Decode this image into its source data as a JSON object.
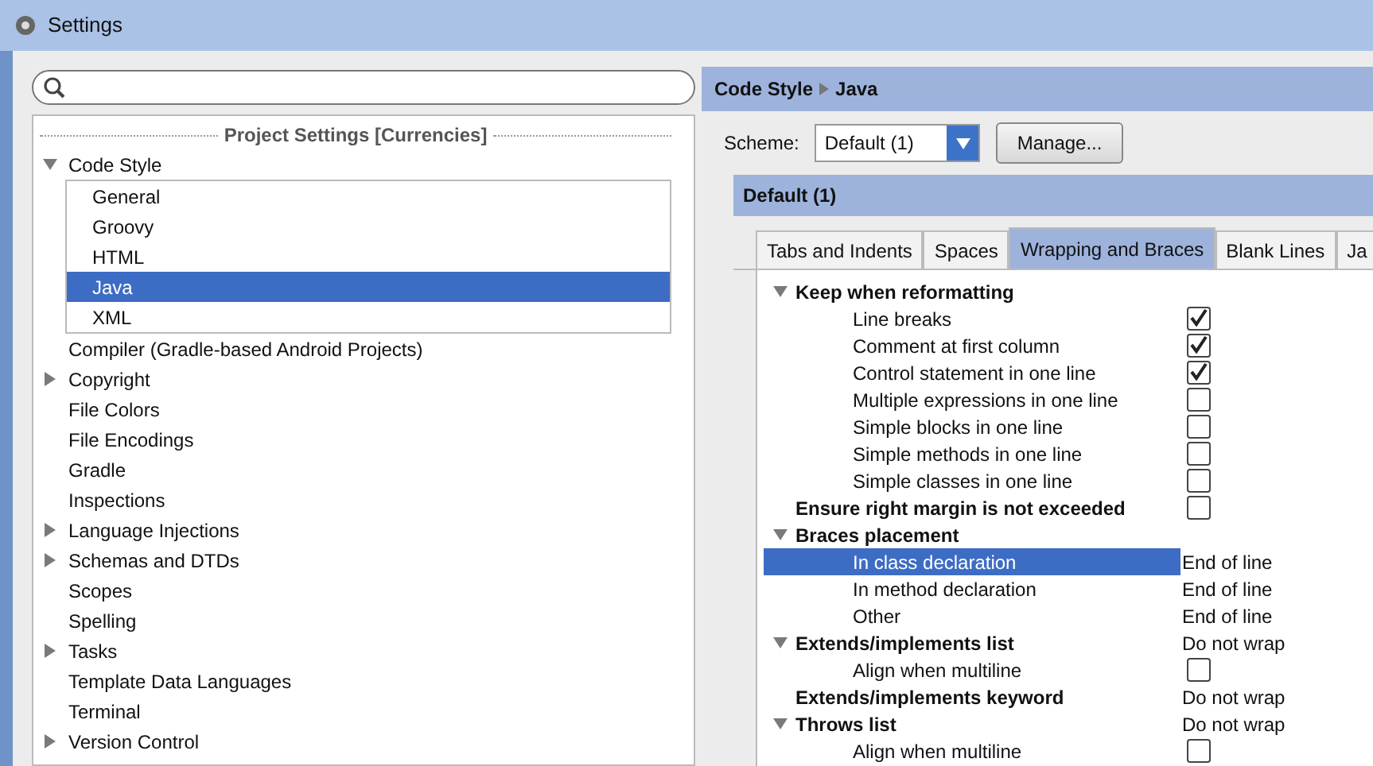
{
  "window": {
    "title": "Settings"
  },
  "tree": {
    "section": "Project Settings [Currencies]",
    "items": [
      {
        "label": "Code Style",
        "expanded": true,
        "selected": false,
        "children": [
          {
            "label": "General",
            "selected": false
          },
          {
            "label": "Groovy",
            "selected": false
          },
          {
            "label": "HTML",
            "selected": false
          },
          {
            "label": "Java",
            "selected": true
          },
          {
            "label": "XML",
            "selected": false
          }
        ]
      },
      {
        "label": "Compiler (Gradle-based Android Projects)",
        "selected": false
      },
      {
        "label": "Copyright",
        "expanded": false,
        "selected": false
      },
      {
        "label": "File Colors",
        "selected": false
      },
      {
        "label": "File Encodings",
        "selected": false
      },
      {
        "label": "Gradle",
        "selected": false
      },
      {
        "label": "Inspections",
        "selected": false
      },
      {
        "label": "Language Injections",
        "expanded": false,
        "selected": false
      },
      {
        "label": "Schemas and DTDs",
        "expanded": false,
        "selected": false
      },
      {
        "label": "Scopes",
        "selected": false
      },
      {
        "label": "Spelling",
        "selected": false
      },
      {
        "label": "Tasks",
        "expanded": false,
        "selected": false
      },
      {
        "label": "Template Data Languages",
        "selected": false
      },
      {
        "label": "Terminal",
        "selected": false
      },
      {
        "label": "Version Control",
        "expanded": false,
        "selected": false
      }
    ]
  },
  "breadcrumb": {
    "parent": "Code Style",
    "current": "Java"
  },
  "scheme": {
    "label": "Scheme:",
    "value": "Default (1)",
    "manage_button": "Manage..."
  },
  "scheme_header": "Default (1)",
  "tabs": [
    {
      "label": "Tabs and Indents",
      "selected": false
    },
    {
      "label": "Spaces",
      "selected": false
    },
    {
      "label": "Wrapping and Braces",
      "selected": true
    },
    {
      "label": "Blank Lines",
      "selected": false
    },
    {
      "label": "Ja",
      "selected": false
    }
  ],
  "options": [
    {
      "kind": "group",
      "label": "Keep when reformatting",
      "expanded": true,
      "selected": false,
      "children": [
        {
          "kind": "checkbox",
          "label": "Line breaks",
          "checked": true,
          "selected": false
        },
        {
          "kind": "checkbox",
          "label": "Comment at first column",
          "checked": true,
          "selected": false
        },
        {
          "kind": "checkbox",
          "label": "Control statement in one line",
          "checked": true,
          "selected": false
        },
        {
          "kind": "checkbox",
          "label": "Multiple expressions in one line",
          "checked": false,
          "selected": false
        },
        {
          "kind": "checkbox",
          "label": "Simple blocks in one line",
          "checked": false,
          "selected": false
        },
        {
          "kind": "checkbox",
          "label": "Simple methods in one line",
          "checked": false,
          "selected": false
        },
        {
          "kind": "checkbox",
          "label": "Simple classes in one line",
          "checked": false,
          "selected": false
        }
      ]
    },
    {
      "kind": "checkbox",
      "label": "Ensure right margin is not exceeded",
      "checked": false,
      "selected": false
    },
    {
      "kind": "group",
      "label": "Braces placement",
      "expanded": true,
      "selected": false,
      "children": [
        {
          "kind": "value",
          "label": "In class declaration",
          "value": "End of line",
          "selected": true
        },
        {
          "kind": "value",
          "label": "In method declaration",
          "value": "End of line",
          "selected": false
        },
        {
          "kind": "value",
          "label": "Other",
          "value": "End of line",
          "selected": false
        }
      ]
    },
    {
      "kind": "group",
      "label": "Extends/implements list",
      "value": "Do not wrap",
      "expanded": true,
      "selected": false,
      "children": [
        {
          "kind": "checkbox",
          "label": "Align when multiline",
          "checked": false,
          "selected": false
        }
      ]
    },
    {
      "kind": "value",
      "label": "Extends/implements keyword",
      "value": "Do not wrap",
      "selected": false
    },
    {
      "kind": "group",
      "label": "Throws list",
      "value": "Do not wrap",
      "expanded": true,
      "selected": false,
      "children": [
        {
          "kind": "checkbox",
          "label": "Align when multiline",
          "checked": false,
          "selected": false
        }
      ]
    }
  ]
}
